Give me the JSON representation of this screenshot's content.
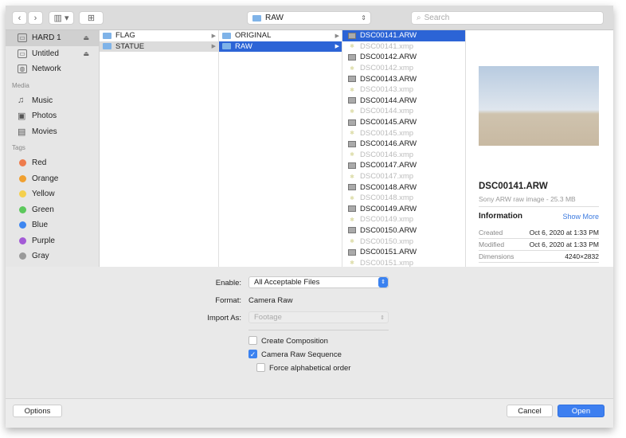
{
  "toolbar": {
    "back": "‹",
    "forward": "›",
    "view": "▥ ▾",
    "new_folder": "⊞",
    "path": "RAW",
    "search_placeholder": "Search"
  },
  "sidebar": {
    "locations": [
      {
        "label": "HARD 1",
        "eject": "⏏",
        "selected": true
      },
      {
        "label": "Untitled",
        "eject": "⏏"
      },
      {
        "label": "Network"
      }
    ],
    "media_heading": "Media",
    "media": [
      {
        "label": "Music",
        "icon": "♫"
      },
      {
        "label": "Photos",
        "icon": "▣"
      },
      {
        "label": "Movies",
        "icon": "▤"
      }
    ],
    "tags_heading": "Tags",
    "tags": [
      {
        "label": "Red",
        "color": "#ee7c4d"
      },
      {
        "label": "Orange",
        "color": "#f0a030"
      },
      {
        "label": "Yellow",
        "color": "#f5d04d"
      },
      {
        "label": "Green",
        "color": "#5cc85c"
      },
      {
        "label": "Blue",
        "color": "#3d86f0"
      },
      {
        "label": "Purple",
        "color": "#a35ad6"
      },
      {
        "label": "Gray",
        "color": "#999999"
      }
    ]
  },
  "columns": [
    [
      {
        "label": "FLAG"
      },
      {
        "label": "STATUE",
        "state": "gray"
      }
    ],
    [
      {
        "label": "ORIGINAL"
      },
      {
        "label": "RAW",
        "state": "sel"
      }
    ]
  ],
  "files": [
    "DSC00141.ARW",
    "DSC00141.xmp",
    "DSC00142.ARW",
    "DSC00142.xmp",
    "DSC00143.ARW",
    "DSC00143.xmp",
    "DSC00144.ARW",
    "DSC00144.xmp",
    "DSC00145.ARW",
    "DSC00145.xmp",
    "DSC00146.ARW",
    "DSC00146.xmp",
    "DSC00147.ARW",
    "DSC00147.xmp",
    "DSC00148.ARW",
    "DSC00148.xmp",
    "DSC00149.ARW",
    "DSC00149.xmp",
    "DSC00150.ARW",
    "DSC00150.xmp",
    "DSC00151.ARW",
    "DSC00151.xmp"
  ],
  "selected_file": "DSC00141.ARW",
  "preview": {
    "name": "DSC00141.ARW",
    "kind": "Sony ARW raw image - 25.3 MB",
    "info_heading": "Information",
    "show_more": "Show More",
    "rows": [
      {
        "label": "Created",
        "value": "Oct 6, 2020 at 1:33 PM"
      },
      {
        "label": "Modified",
        "value": "Oct 6, 2020 at 1:33 PM"
      },
      {
        "label": "Dimensions",
        "value": "4240×2832"
      }
    ]
  },
  "options": {
    "enable_label": "Enable:",
    "enable_value": "All Acceptable Files",
    "format_label": "Format:",
    "format_value": "Camera Raw",
    "import_label": "Import As:",
    "import_value": "Footage",
    "create_comp": "Create Composition",
    "create_comp_checked": false,
    "sequence": "Camera Raw Sequence",
    "sequence_checked": true,
    "force_alpha": "Force alphabetical order",
    "force_alpha_checked": false
  },
  "footer": {
    "options": "Options",
    "cancel": "Cancel",
    "open": "Open"
  },
  "accent": "#2c64d6"
}
